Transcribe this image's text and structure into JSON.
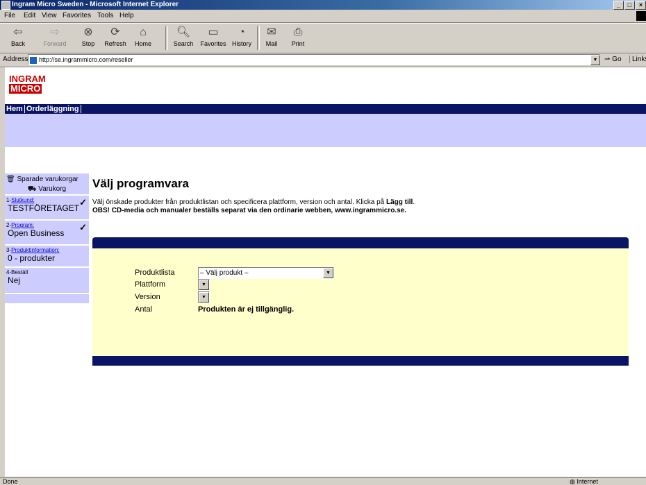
{
  "window": {
    "title": "Ingram Micro Sweden - Microsoft Internet Explorer",
    "buttons": [
      "_",
      "□",
      "×"
    ]
  },
  "menu": [
    "File",
    "Edit",
    "View",
    "Favorites",
    "Tools",
    "Help"
  ],
  "toolbar": {
    "back": "Back",
    "forward": "Forward",
    "stop": "Stop",
    "refresh": "Refresh",
    "home": "Home",
    "search": "Search",
    "favorites": "Favorites",
    "history": "History",
    "mail": "Mail",
    "print": "Print"
  },
  "address": {
    "label": "Address",
    "url": "http://se.ingrammicro.com/reseller",
    "go": "Go",
    "links": "Links"
  },
  "logo": {
    "line1": "INGRAM",
    "line2": "MICRO"
  },
  "nav": [
    "Hem",
    "Orderläggning"
  ],
  "sidebar": {
    "saved_carts": "Sparade varukorgar",
    "cart": "Varukorg",
    "steps": [
      {
        "num": "1-",
        "title": "Slutkund:",
        "value": "TESTFÖRETAGET",
        "done": true
      },
      {
        "num": "2-",
        "title": "Program:",
        "value": "Open Business",
        "done": true
      },
      {
        "num": "3-",
        "title": "Produktinformation:",
        "value": "0 - produkter",
        "done": false
      },
      {
        "num": "4-",
        "title": "Beställ",
        "value": "Nej",
        "done": false
      }
    ]
  },
  "main": {
    "heading": "Välj programvara",
    "intro_pre": "Välj önskade produkter från produktlistan och specificera plattform, version och antal. Klicka på ",
    "intro_bold": "Lägg till",
    "intro_post": ".",
    "notice": "OBS! CD-media och manualer beställs separat via den ordinarie webben, www.ingrammicro.se."
  },
  "form": {
    "product_label": "Produktlista",
    "product_value": "– Välj produkt –",
    "platform_label": "Plattform",
    "version_label": "Version",
    "qty_label": "Antal",
    "qty_value": "Produkten är ej tillgänglig."
  },
  "status": {
    "text": "Done",
    "zone": "Internet"
  }
}
